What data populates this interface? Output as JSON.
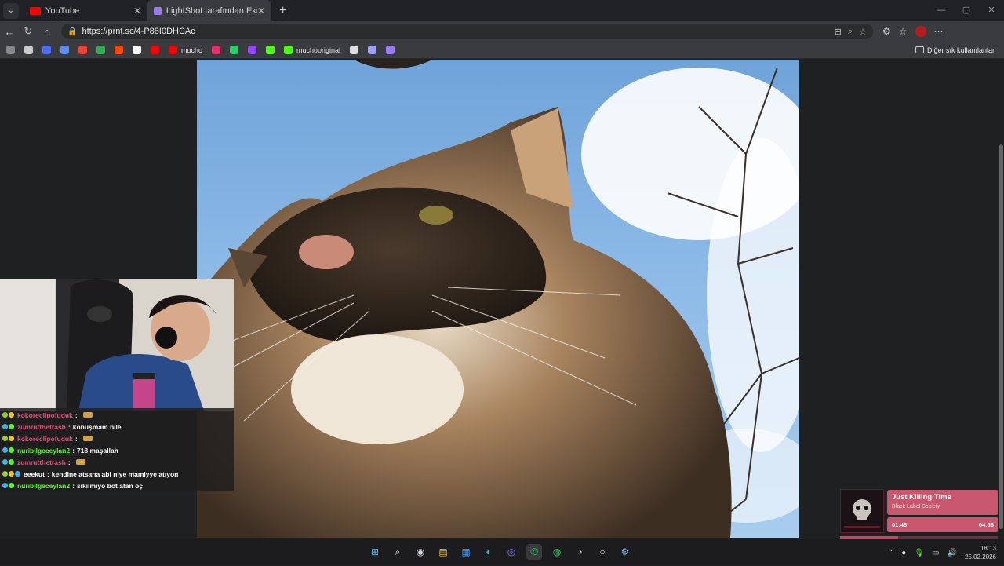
{
  "tabs": [
    {
      "label": "YouTube",
      "color": "#ff0000"
    },
    {
      "label": "LightShot tarafından Ekran Görüntüsü",
      "color": "#9b7cf0"
    }
  ],
  "address": {
    "url": "https://prnt.sc/4-P88I0DHCAc"
  },
  "bookmarks": [
    {
      "label": "",
      "color": "#888888",
      "icon": "screen-icon"
    },
    {
      "label": "",
      "color": "#cccccc",
      "icon": "image-icon"
    },
    {
      "label": "",
      "color": "#4e6cf5",
      "icon": "circle-icon"
    },
    {
      "label": "",
      "color": "#5a8ff7",
      "icon": "docs-icon"
    },
    {
      "label": "",
      "color": "#ea4335",
      "icon": "gmail-icon"
    },
    {
      "label": "",
      "color": "#34a853",
      "icon": "google-icon"
    },
    {
      "label": "",
      "color": "#ff4500",
      "icon": "reddit-icon"
    },
    {
      "label": "",
      "color": "#ffffff",
      "icon": "x-icon"
    },
    {
      "label": "",
      "color": "#ff0000",
      "icon": "youtube-icon"
    },
    {
      "label": "mucho",
      "color": "#ff0000",
      "icon": "youtube-icon"
    },
    {
      "label": "",
      "color": "#e1306c",
      "icon": "instagram-icon"
    },
    {
      "label": "",
      "color": "#25d366",
      "icon": "whatsapp-icon"
    },
    {
      "label": "",
      "color": "#9146ff",
      "icon": "twitch-icon"
    },
    {
      "label": "",
      "color": "#53fc18",
      "icon": "kick-icon"
    },
    {
      "label": "muchooriginal",
      "color": "#53fc18",
      "icon": "kick-icon"
    },
    {
      "label": "",
      "color": "#dddddd",
      "icon": "gear-icon"
    },
    {
      "label": "",
      "color": "#a0a0ff",
      "icon": "swirl-icon"
    },
    {
      "label": "",
      "color": "#9b7cf0",
      "icon": "feather-icon"
    }
  ],
  "bookmarks_other": "Diğer sık kullanılanlar",
  "chat": [
    {
      "user": "kokoreclipofuduk",
      "user_color": "#e94b7b",
      "msg": "",
      "emote": true,
      "badges": [
        "#9acd32",
        "#f5c518"
      ]
    },
    {
      "user": "zumrutthetrash",
      "user_color": "#e94b7b",
      "msg": "konuşmam bile",
      "emote": false,
      "badges": [
        "#3ab4f2",
        "#53fc18"
      ]
    },
    {
      "user": "kokoreclipofuduk",
      "user_color": "#e94b7b",
      "msg": "",
      "emote": true,
      "badges": [
        "#9acd32",
        "#f5c518"
      ]
    },
    {
      "user": "nuribilgeceylan2",
      "user_color": "#53fc18",
      "msg": "718 maşallah",
      "emote": false,
      "badges": [
        "#3ab4f2",
        "#53fc18"
      ]
    },
    {
      "user": "zumrutthetrash",
      "user_color": "#e94b7b",
      "msg": "",
      "emote": true,
      "badges": [
        "#3ab4f2",
        "#53fc18"
      ]
    },
    {
      "user": "eeekut",
      "user_color": "#ffffff",
      "msg": "kendine atsana abi niye mamiyye atıyon",
      "emote": false,
      "badges": [
        "#9acd32",
        "#f5c518",
        "#3ab4f2"
      ]
    },
    {
      "user": "nuribilgeceylan2",
      "user_color": "#53fc18",
      "msg": "sıkılmıyo bot atan oç",
      "emote": false,
      "badges": [
        "#3ab4f2",
        "#53fc18"
      ]
    }
  ],
  "music": {
    "title": "Just Killing Time",
    "artist": "Black Label Society",
    "elapsed": "01:48",
    "total": "04:56",
    "progress": 0.365
  },
  "taskbar": {
    "apps": [
      "windows-icon",
      "search-icon",
      "steam-icon",
      "folder-icon",
      "store-icon",
      "edge-icon",
      "discord-icon",
      "whatsapp-icon",
      "spotify-icon",
      "chrome-icon",
      "obs-icon",
      "settings-icon"
    ],
    "time": "18:13",
    "date": "25.02.2026"
  }
}
